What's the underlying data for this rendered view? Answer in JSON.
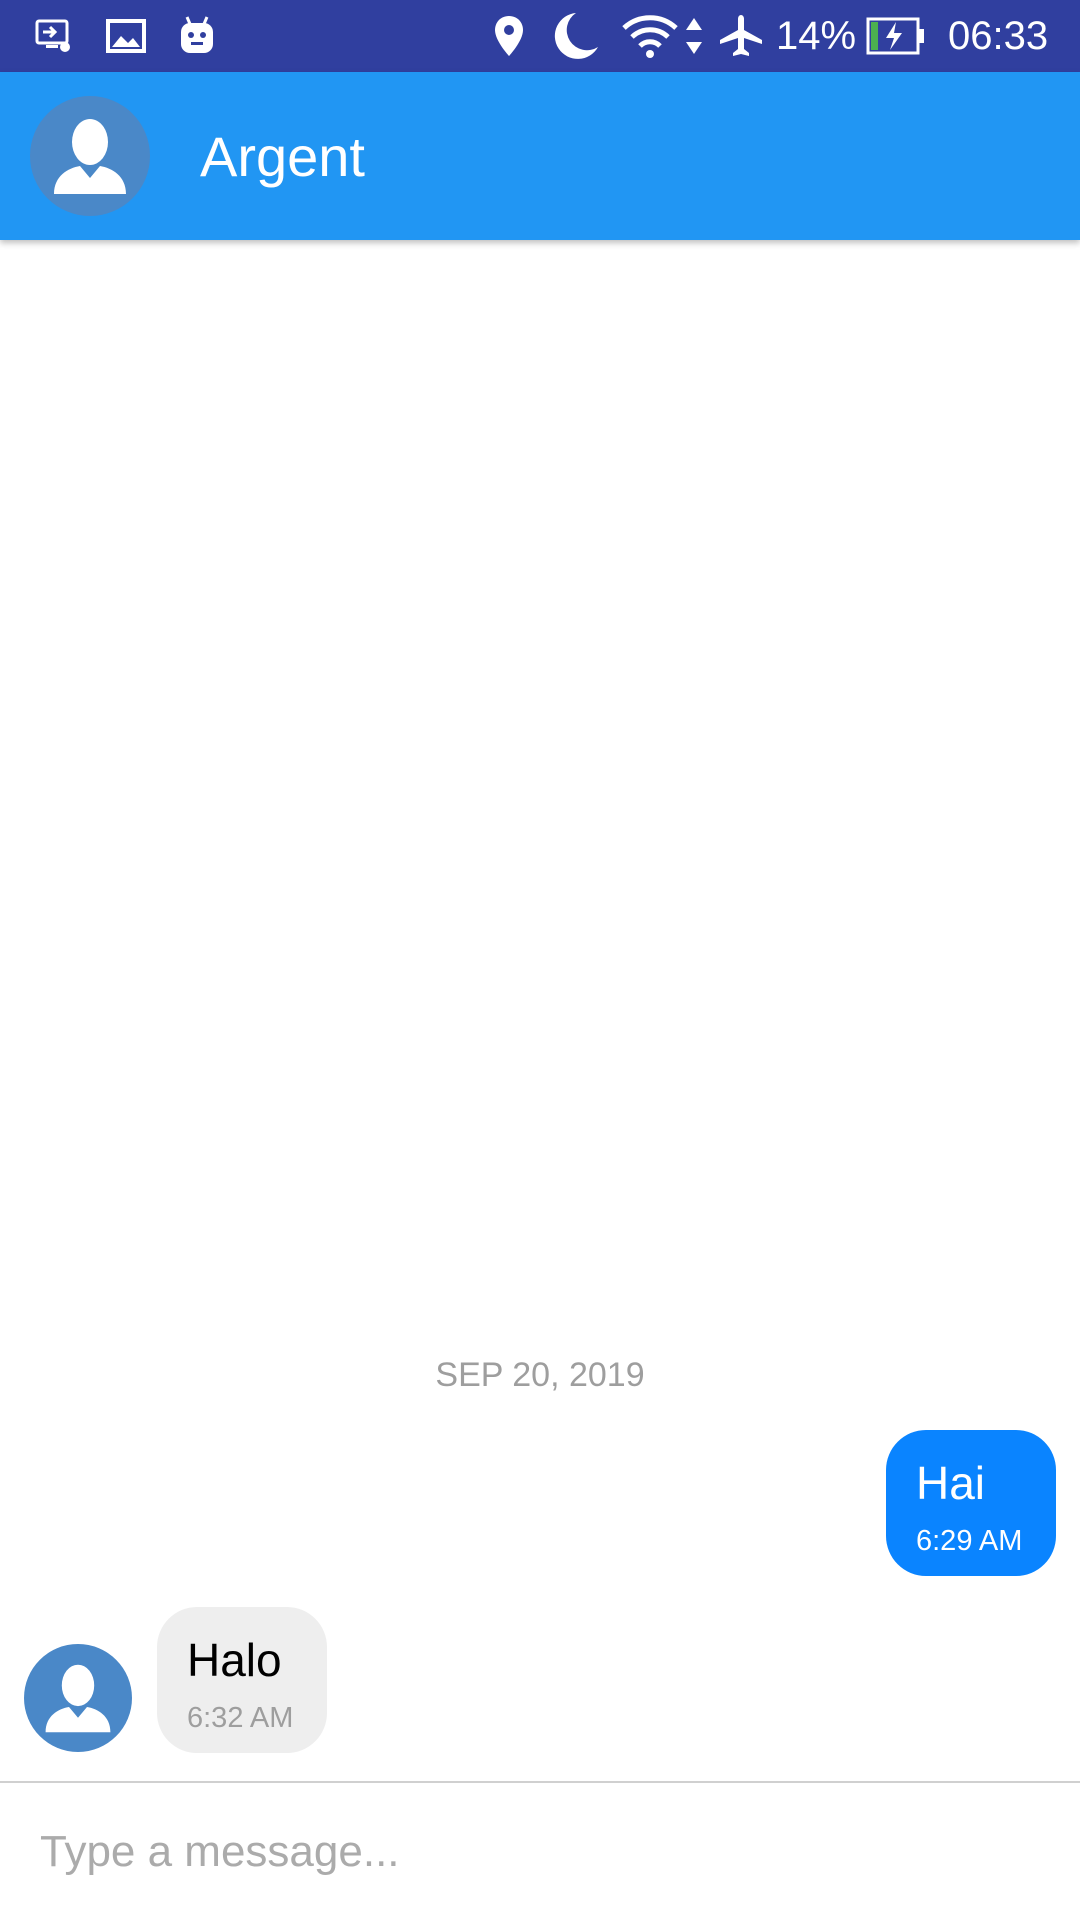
{
  "status_bar": {
    "battery_percent": "14%",
    "time": "06:33",
    "icons": [
      "screen-cast-icon",
      "image-icon",
      "android-icon",
      "location-icon",
      "do-not-disturb-moon-icon",
      "wifi-icon",
      "data-arrows-icon",
      "airplane-icon",
      "battery-charging-icon"
    ]
  },
  "toolbar": {
    "title": "Argent",
    "avatar_icon": "person-avatar-icon"
  },
  "conversation": {
    "date_separator": "SEP 20, 2019",
    "messages": [
      {
        "direction": "outgoing",
        "text": "Hai",
        "time": "6:29 AM"
      },
      {
        "direction": "incoming",
        "text": "Halo",
        "time": "6:32 AM"
      }
    ]
  },
  "composer": {
    "placeholder": "Type a message...",
    "value": ""
  },
  "colors": {
    "status_bar": "#303F9F",
    "toolbar": "#2196F3",
    "outgoing_bubble": "#0A84FF",
    "incoming_bubble": "#EEEEEE",
    "avatar": "#4A88C8"
  }
}
